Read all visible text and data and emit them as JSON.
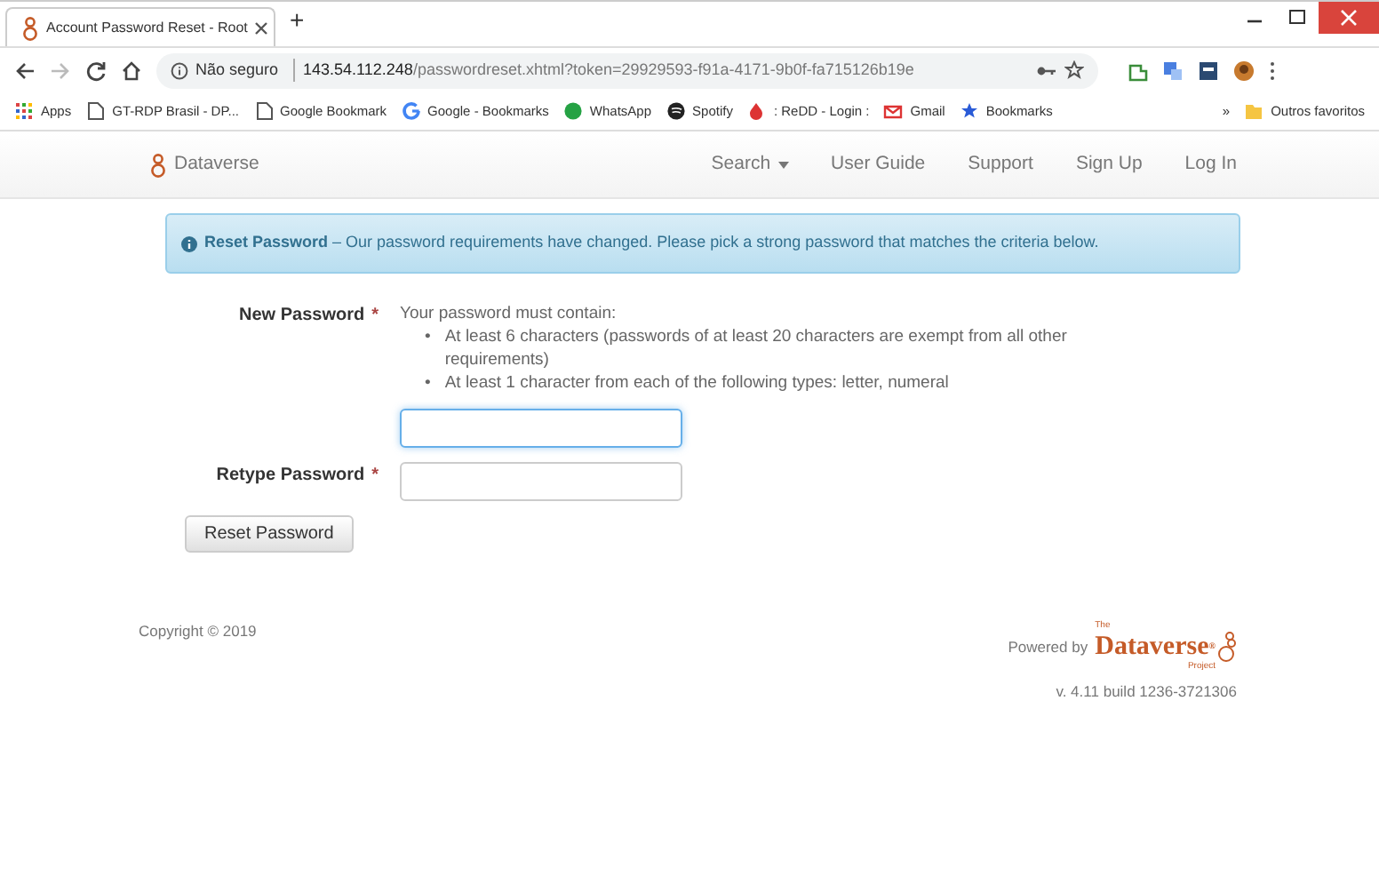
{
  "browser": {
    "tab_title": "Account Password Reset - Root",
    "new_tab": "+",
    "insecure_label": "Não seguro",
    "url_host": "143.54.112.248",
    "url_path": "/passwordreset.xhtml?token=29929593-f91a-4171-9b0f-fa715126b19e",
    "bookmarks": [
      {
        "label": "Apps",
        "kind": "apps"
      },
      {
        "label": "GT-RDP Brasil - DP...",
        "kind": "page"
      },
      {
        "label": "Google Bookmark",
        "kind": "page"
      },
      {
        "label": "Google - Bookmarks",
        "kind": "google"
      },
      {
        "label": "WhatsApp",
        "kind": "whatsapp"
      },
      {
        "label": "Spotify",
        "kind": "spotify"
      },
      {
        "label": ": ReDD - Login :",
        "kind": "redd"
      },
      {
        "label": "Gmail",
        "kind": "gmail"
      },
      {
        "label": "Bookmarks",
        "kind": "star"
      }
    ],
    "overflow": "»",
    "other_bookmarks": "Outros favoritos"
  },
  "navbar": {
    "brand": "Dataverse",
    "items": [
      {
        "label": "Search",
        "kind": "dropdown"
      },
      {
        "label": "User Guide",
        "kind": "link"
      },
      {
        "label": "Support",
        "kind": "link"
      },
      {
        "label": "Sign Up",
        "kind": "link"
      },
      {
        "label": "Log In",
        "kind": "link"
      }
    ]
  },
  "alert": {
    "title": "Reset Password",
    "message": " – Our password requirements have changed. Please pick a strong password that matches the criteria below."
  },
  "form": {
    "requirements_intro": "Your password must contain:",
    "requirements": [
      "At least 6 characters (passwords of at least 20 characters are exempt from all other requirements)",
      "At least 1 character from each of the following types: letter, numeral"
    ],
    "bullet": "•",
    "fields": [
      {
        "label": "New Password",
        "required": true,
        "required_mark": "*",
        "focused": true
      },
      {
        "label": "Retype Password",
        "required": true,
        "required_mark": "*",
        "focused": false
      }
    ],
    "button": "Reset Password"
  },
  "footer": {
    "copyright": "Copyright © 2019",
    "powered_by": "Powered by",
    "logo_top": "The",
    "logo_name": "Dataverse",
    "logo_mark": "®",
    "logo_bottom": "Project",
    "version": "v. 4.11 build 1236-3721306"
  }
}
